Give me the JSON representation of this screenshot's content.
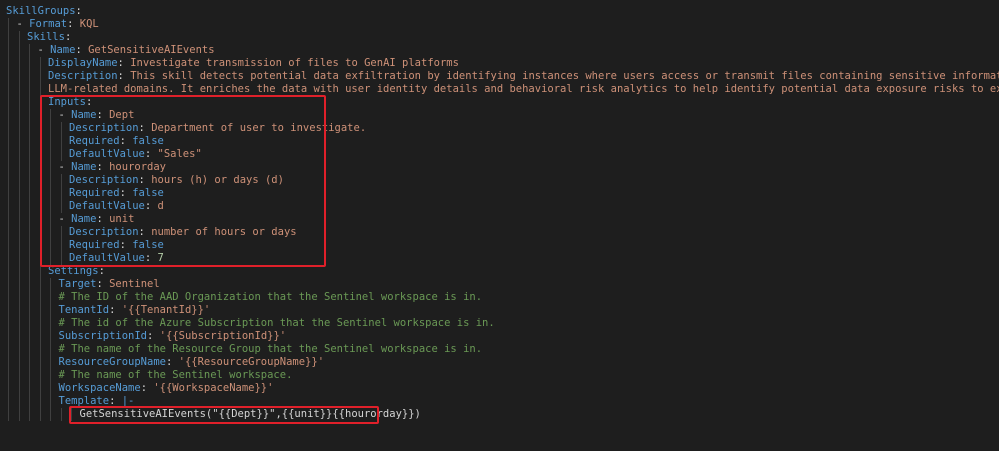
{
  "lines": [
    {
      "indent": 0,
      "key": "SkillGroups",
      "sep": ":",
      "value": "",
      "vtype": ""
    },
    {
      "indent": 1,
      "dash": true,
      "key": "Format",
      "sep": ": ",
      "value": "KQL",
      "vtype": "s"
    },
    {
      "indent": 2,
      "key": "Skills",
      "sep": ":",
      "value": "",
      "vtype": ""
    },
    {
      "indent": 3,
      "dash": true,
      "key": "Name",
      "sep": ": ",
      "value": "GetSensitiveAIEvents",
      "vtype": "s"
    },
    {
      "indent": 4,
      "key": "DisplayName",
      "sep": ": ",
      "value": "Investigate transmission of files to GenAI platforms",
      "vtype": "s"
    },
    {
      "indent": 4,
      "key": "Description",
      "sep": ": ",
      "value": "This skill detects potential data exfiltration by identifying instances where users access or transmit files containing sensitive information to known generative AI or",
      "vtype": "s"
    },
    {
      "indent": 4,
      "key": "",
      "sep": "",
      "value": "LLM-related domains. It enriches the data with user identity details and behavioral risk analytics to help identify potential data exposure risks to external AI platforms",
      "vtype": "s"
    },
    {
      "indent": 4,
      "key": "Inputs",
      "sep": ":",
      "value": "",
      "vtype": ""
    },
    {
      "indent": 5,
      "dash": true,
      "key": "Name",
      "sep": ": ",
      "value": "Dept",
      "vtype": "s"
    },
    {
      "indent": 6,
      "key": "Description",
      "sep": ": ",
      "value": "Department of user to investigate.",
      "vtype": "s"
    },
    {
      "indent": 6,
      "key": "Required",
      "sep": ": ",
      "value": "false",
      "vtype": "kw"
    },
    {
      "indent": 6,
      "key": "DefaultValue",
      "sep": ": ",
      "value": "\"Sales\"",
      "vtype": "s"
    },
    {
      "indent": 5,
      "dash": true,
      "key": "Name",
      "sep": ": ",
      "value": "hourorday",
      "vtype": "s"
    },
    {
      "indent": 6,
      "key": "Description",
      "sep": ": ",
      "value": "hours (h) or days (d)",
      "vtype": "s"
    },
    {
      "indent": 6,
      "key": "Required",
      "sep": ": ",
      "value": "false",
      "vtype": "kw"
    },
    {
      "indent": 6,
      "key": "DefaultValue",
      "sep": ": ",
      "value": "d",
      "vtype": "s"
    },
    {
      "indent": 5,
      "dash": true,
      "key": "Name",
      "sep": ": ",
      "value": "unit",
      "vtype": "s"
    },
    {
      "indent": 6,
      "key": "Description",
      "sep": ": ",
      "value": "number of hours or days",
      "vtype": "s"
    },
    {
      "indent": 6,
      "key": "Required",
      "sep": ": ",
      "value": "false",
      "vtype": "kw"
    },
    {
      "indent": 6,
      "key": "DefaultValue",
      "sep": ": ",
      "value": "7",
      "vtype": "n"
    },
    {
      "indent": 4,
      "key": "Settings",
      "sep": ":",
      "value": "",
      "vtype": ""
    },
    {
      "indent": 5,
      "key": "Target",
      "sep": ": ",
      "value": "Sentinel",
      "vtype": "s"
    },
    {
      "indent": 5,
      "comment": "# The ID of the AAD Organization that the Sentinel workspace is in."
    },
    {
      "indent": 5,
      "key": "TenantId",
      "sep": ": ",
      "value": "'{{TenantId}}'",
      "vtype": "s"
    },
    {
      "indent": 5,
      "comment": "# The id of the Azure Subscription that the Sentinel workspace is in."
    },
    {
      "indent": 5,
      "key": "SubscriptionId",
      "sep": ": ",
      "value": "'{{SubscriptionId}}'",
      "vtype": "s"
    },
    {
      "indent": 5,
      "comment": "# The name of the Resource Group that the Sentinel workspace is in."
    },
    {
      "indent": 5,
      "key": "ResourceGroupName",
      "sep": ": ",
      "value": "'{{ResourceGroupName}}'",
      "vtype": "s"
    },
    {
      "indent": 5,
      "comment": "# The name of the Sentinel workspace."
    },
    {
      "indent": 5,
      "key": "WorkspaceName",
      "sep": ": ",
      "value": "'{{WorkspaceName}}'",
      "vtype": "s"
    },
    {
      "indent": 5,
      "key": "Template",
      "sep": ": ",
      "value": "|-",
      "vtype": "kw"
    },
    {
      "indent": 7,
      "raw": "GetSensitiveAIEvents(\"{{Dept}}\",{{unit}}{{hourorday}})"
    }
  ]
}
